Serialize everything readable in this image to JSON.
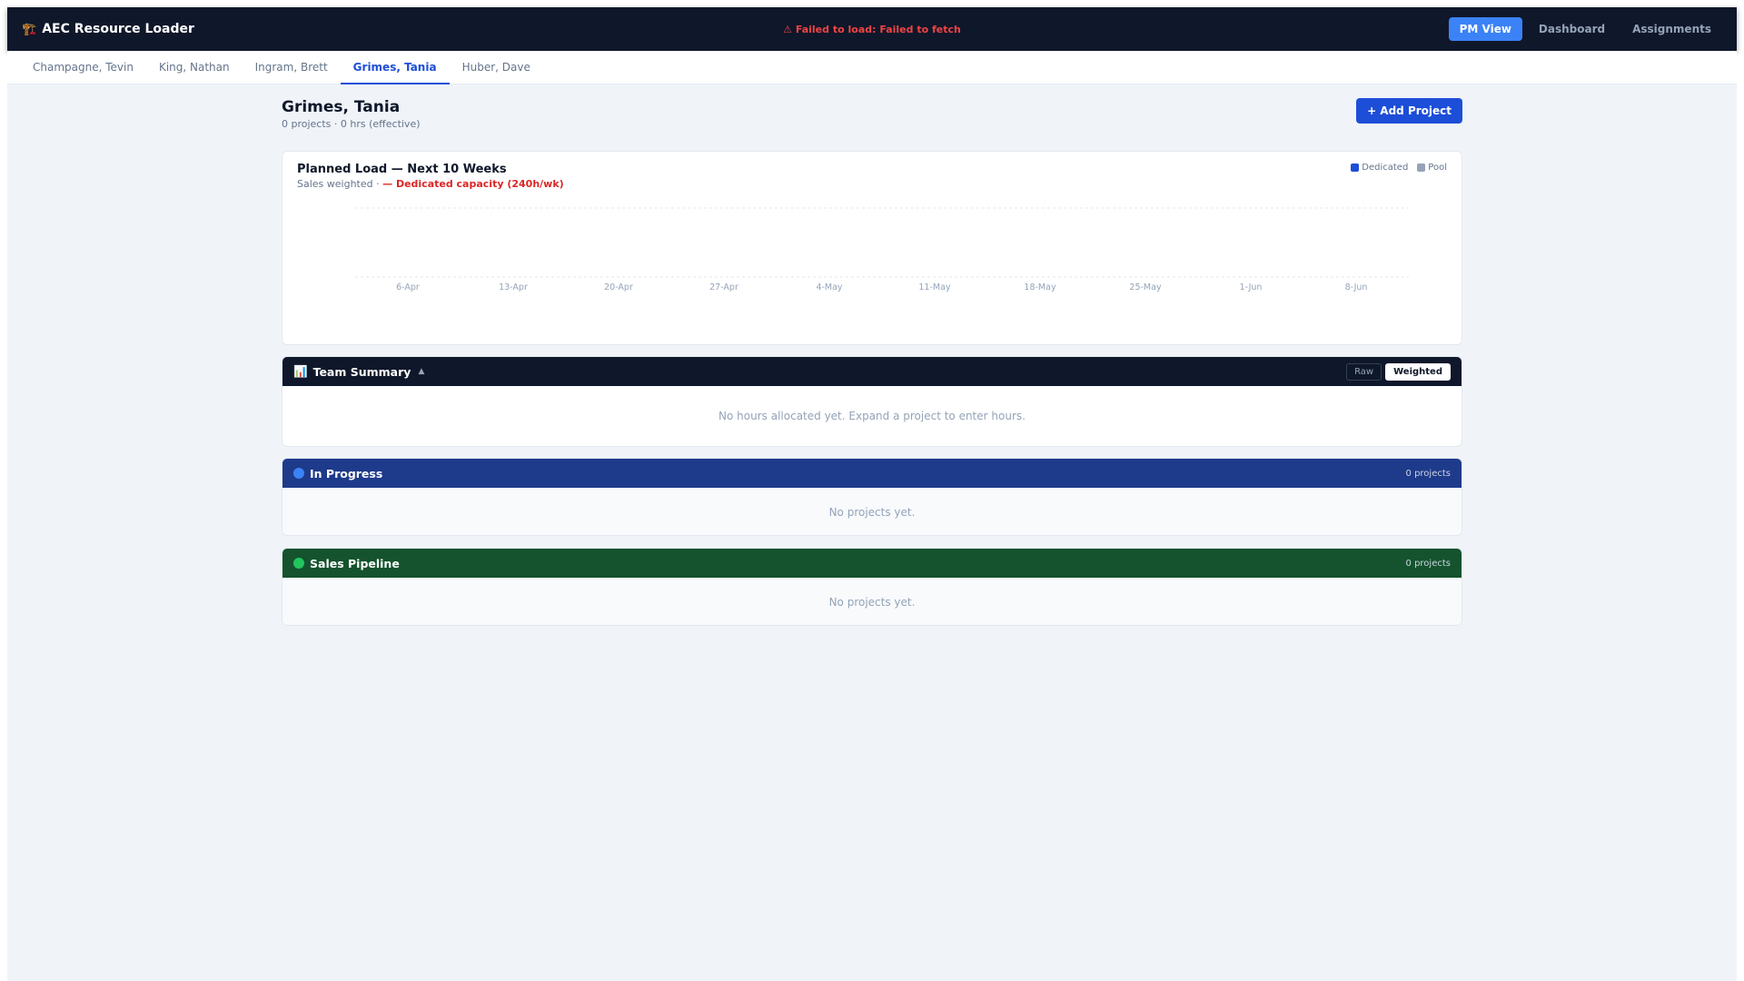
{
  "app": {
    "title": "AEC Resource Loader",
    "icon": "construction-crane-icon",
    "error": "⚠ Failed to load: Failed to fetch"
  },
  "nav": {
    "items": [
      {
        "label": "PM View",
        "active": true
      },
      {
        "label": "Dashboard",
        "active": false
      },
      {
        "label": "Assignments",
        "active": false
      }
    ]
  },
  "tabs": [
    {
      "label": "Champagne, Tevin",
      "active": false
    },
    {
      "label": "King, Nathan",
      "active": false
    },
    {
      "label": "Ingram, Brett",
      "active": false
    },
    {
      "label": "Grimes, Tania",
      "active": true
    },
    {
      "label": "Huber, Dave",
      "active": false
    }
  ],
  "page": {
    "title": "Grimes, Tania",
    "subtitle": "0 projects · 0 hrs (effective)",
    "add_button": "+ Add Project"
  },
  "chart_data": {
    "type": "bar",
    "title": "Planned Load — Next 10 Weeks",
    "subtitle_prefix": "Sales weighted · ",
    "subtitle_capacity": "— Dedicated capacity (240h/wk)",
    "categories": [
      "6-Apr",
      "13-Apr",
      "20-Apr",
      "27-Apr",
      "4-May",
      "11-May",
      "18-May",
      "25-May",
      "1-Jun",
      "8-Jun"
    ],
    "series": [
      {
        "name": "Dedicated",
        "color": "#1d4ed8",
        "values": [
          0,
          0,
          0,
          0,
          0,
          0,
          0,
          0,
          0,
          0
        ]
      },
      {
        "name": "Pool",
        "color": "#94a3b8",
        "values": [
          0,
          0,
          0,
          0,
          0,
          0,
          0,
          0,
          0,
          0
        ]
      }
    ],
    "capacity": 240,
    "capacity_color": "#dc2626",
    "grid": true
  },
  "team_summary": {
    "title": "Team Summary",
    "icon": "bar-chart-icon",
    "toggle": [
      {
        "label": "Raw",
        "active": false
      },
      {
        "label": "Weighted",
        "active": true
      }
    ],
    "empty": "No hours allocated yet. Expand a project to enter hours."
  },
  "in_progress": {
    "title": "In Progress",
    "count": "0 projects",
    "empty": "No projects yet.",
    "dot_color": "#3b82f6"
  },
  "sales_pipeline": {
    "title": "Sales Pipeline",
    "count": "0 projects",
    "empty": "No projects yet.",
    "dot_color": "#22c55e"
  }
}
